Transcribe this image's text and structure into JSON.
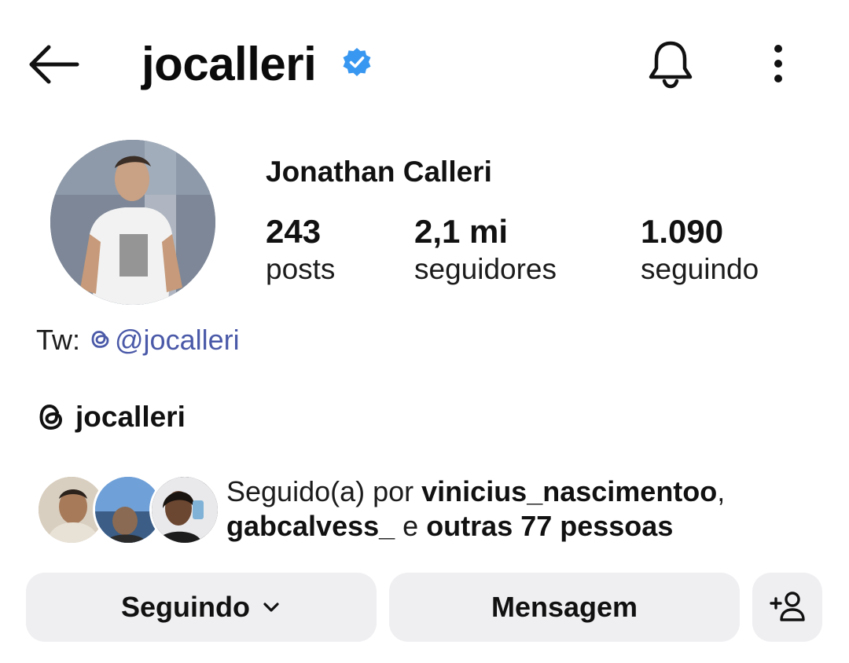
{
  "header": {
    "username": "jocalleri",
    "icons": {
      "back": "arrow-left-icon",
      "verified": "verified-badge-icon",
      "notifications": "bell-icon",
      "more": "more-vertical-icon"
    }
  },
  "profile": {
    "full_name": "Jonathan Calleri",
    "stats": {
      "posts": {
        "value": "243",
        "label": "posts"
      },
      "followers": {
        "value": "2,1 mi",
        "label": "seguidores"
      },
      "following": {
        "value": "1.090",
        "label": "seguindo"
      }
    },
    "bio": {
      "prefix": "Tw: ",
      "link_text": "@jocalleri"
    },
    "threads": {
      "handle": "jocalleri",
      "icon": "threads-icon"
    }
  },
  "followed_by": {
    "prefix": "Seguido(a) por ",
    "user1": "vinicius_nascimentoo",
    "separator": ",",
    "user2": "gabcalvess_",
    "conjunction": " e ",
    "others": "outras 77 pessoas"
  },
  "buttons": {
    "following": "Seguindo",
    "message": "Mensagem",
    "add_icon": "add-person-icon"
  },
  "colors": {
    "verified": "#3897f0",
    "link": "#4a59a8",
    "button_bg": "#efeff2"
  }
}
